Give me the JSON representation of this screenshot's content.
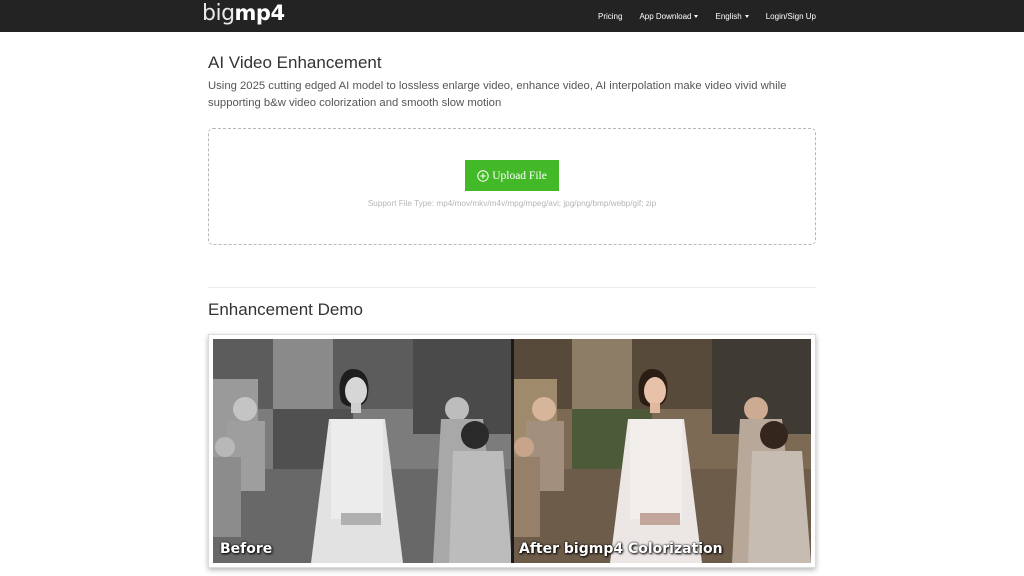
{
  "nav": {
    "logo_big": "big",
    "logo_mp4": "mp4",
    "links": {
      "pricing": "Pricing",
      "app_download": "App Download",
      "language": "English",
      "login": "Login/Sign Up"
    }
  },
  "main": {
    "title": "AI Video Enhancement",
    "description": "Using 2025 cutting edged AI model to lossless enlarge video, enhance video, AI interpolation make video vivid while supporting b&w video colorization and smooth slow motion",
    "upload": {
      "button_label": "Upload File",
      "support_text": "Support File Type: mp4/mov/mkv/m4v/mpg/mpeg/avi; jpg/png/bmp/webp/gif; zip"
    }
  },
  "demo": {
    "title": "Enhancement Demo",
    "before_label": "Before",
    "after_label": "After bigmp4 Colorization"
  },
  "colors": {
    "navbar_bg": "#232323",
    "upload_button": "#44b928"
  },
  "icons": {
    "upload_button": "plus-circle-icon",
    "nav_dropdown": "caret-down-icon"
  }
}
